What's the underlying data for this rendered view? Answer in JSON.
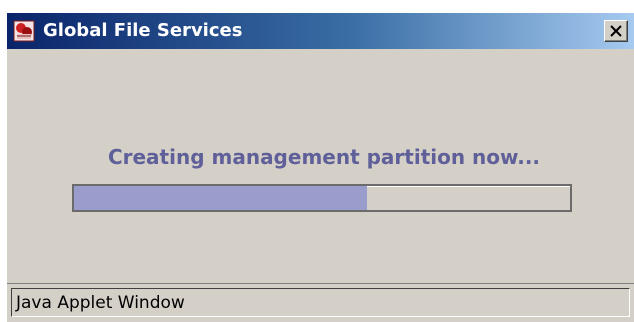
{
  "window": {
    "title": "Global File Services",
    "app_icon": "java-applet-icon",
    "close_icon": "close-x-icon",
    "title_gradient": [
      "#0a246a",
      "#a6caf0"
    ]
  },
  "content": {
    "message": "Creating management partition now...",
    "message_color": "#5f5f99"
  },
  "progress": {
    "value": 0.59,
    "fill_color": "#9a9ccc"
  },
  "statusbar": {
    "text": "Java Applet Window"
  }
}
